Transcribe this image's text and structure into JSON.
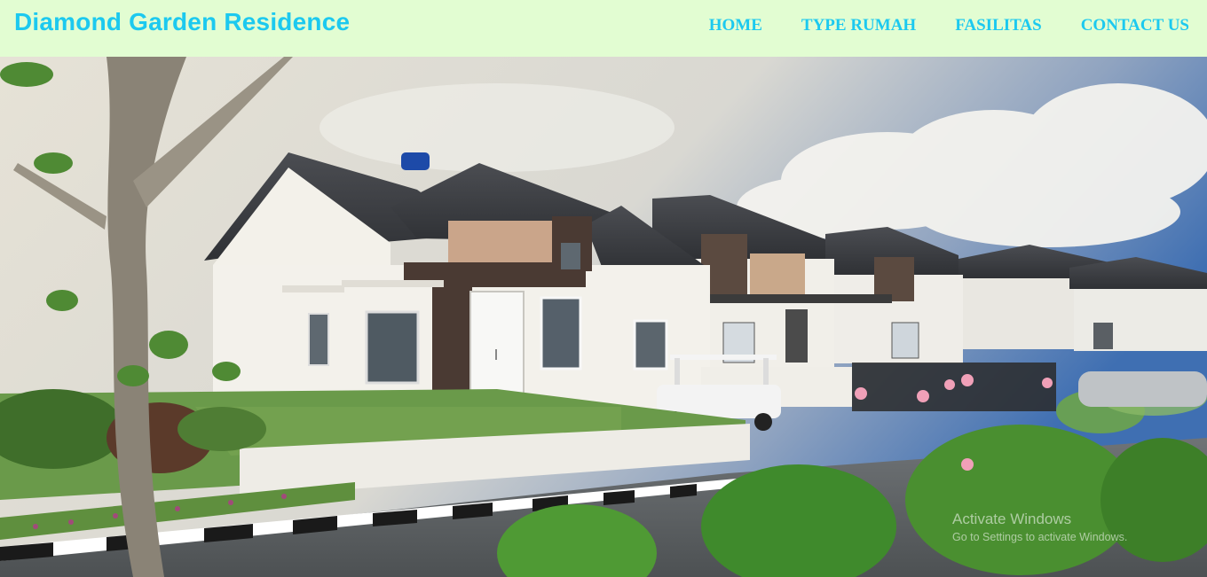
{
  "brand": {
    "name": "Diamond Garden Residence"
  },
  "nav": {
    "items": [
      {
        "label": "HOME"
      },
      {
        "label": "TYPE RUMAH"
      },
      {
        "label": "FASILITAS"
      },
      {
        "label": "CONTACT US"
      }
    ]
  },
  "hero": {
    "image_subject": "residential-houses-photo"
  },
  "watermark": {
    "line1": "Activate Windows",
    "line2": "Go to Settings to activate Windows."
  },
  "colors": {
    "navbar_bg": "#e2fdd2",
    "accent": "#1cc9ef"
  }
}
